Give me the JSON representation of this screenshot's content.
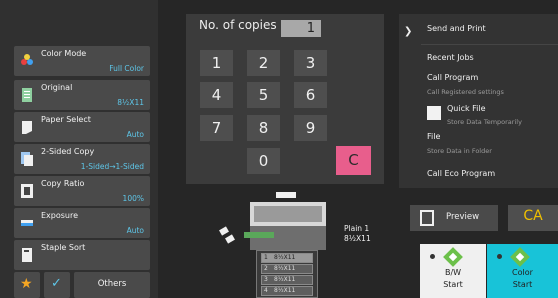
{
  "settings": [
    {
      "label": "Color Mode",
      "value": "Full Color",
      "icon": "color-mode-icon"
    },
    {
      "label": "Original",
      "value": "8½X11",
      "icon": "original-icon"
    },
    {
      "label": "Paper Select",
      "value": "Auto",
      "icon": "paper-select-icon"
    },
    {
      "label": "2-Sided Copy",
      "value": "1-Sided→1-Sided",
      "icon": "two-sided-icon"
    },
    {
      "label": "Copy Ratio",
      "value": "100%",
      "icon": "copy-ratio-icon"
    },
    {
      "label": "Exposure",
      "value": "Auto",
      "icon": "exposure-icon"
    },
    {
      "label": "Staple Sort",
      "value": "",
      "icon": "staple-sort-icon"
    }
  ],
  "bottom_bar": {
    "others_label": "Others",
    "star_icon": "star-icon",
    "check_icon": "check-icon"
  },
  "keypad": {
    "title": "No. of copies",
    "count": "1",
    "keys": [
      "1",
      "2",
      "3",
      "4",
      "5",
      "6",
      "7",
      "8",
      "9",
      "0"
    ],
    "clear_label": "C"
  },
  "right_menu": {
    "send_and_print": "Send and Print",
    "recent_jobs": "Recent Jobs",
    "call_program": "Call Program",
    "call_program_sub": "Call Registered settings",
    "quick_file": "Quick File",
    "quick_file_sub": "Store Data Temporarily",
    "file": "File",
    "file_sub": "Store Data in Folder",
    "call_eco_program": "Call Eco Program"
  },
  "preview_area": {
    "paper_type": "Plain 1",
    "paper_size": "8½X11",
    "trays": [
      {
        "num": "1",
        "size": "8½X11"
      },
      {
        "num": "2",
        "size": "8½X11"
      },
      {
        "num": "3",
        "size": "8½X11"
      },
      {
        "num": "4",
        "size": "8½X11"
      }
    ]
  },
  "actions": {
    "preview_label": "Preview",
    "ca_label": "CA",
    "bw_start_line1": "B/W",
    "bw_start_line2": "Start",
    "color_start_line1": "Color",
    "color_start_line2": "Start"
  },
  "colors": {
    "accent_blue": "#5ec6e8",
    "clear_pink": "#e85e8c",
    "ca_yellow": "#f0c000",
    "color_start_teal": "#18c3d8",
    "bw_start_white": "#f0f0f0",
    "start_green": "#6cc04a"
  }
}
